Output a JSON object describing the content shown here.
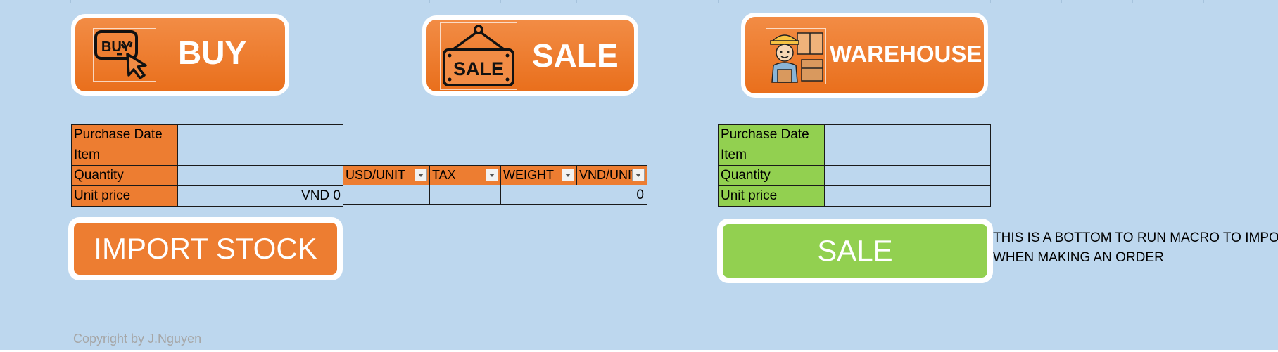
{
  "nav": {
    "buy_label": "BUY",
    "buy_icon_text": "BUY",
    "sale_label": "SALE",
    "sale_icon_text": "SALE",
    "warehouse_label": "WAREHOUSE"
  },
  "purchase_form": {
    "rows": [
      {
        "label": "Purchase Date",
        "value": ""
      },
      {
        "label": "Item",
        "value": ""
      },
      {
        "label": "Quantity",
        "value": ""
      },
      {
        "label": "Unit price",
        "value": "VND 0"
      }
    ]
  },
  "calc": {
    "headers": [
      "USD/UNIT",
      "TAX",
      "WEIGHT",
      "VND/UNIT"
    ],
    "result": "0"
  },
  "sale_form": {
    "rows": [
      {
        "label": "Purchase Date",
        "value": ""
      },
      {
        "label": "Item",
        "value": ""
      },
      {
        "label": "Quantity",
        "value": ""
      },
      {
        "label": "Unit price",
        "value": ""
      }
    ]
  },
  "actions": {
    "import_label": "IMPORT STOCK",
    "sale_label": "SALE"
  },
  "note": {
    "line1": "THIS IS A BOTTOM TO RUN MACRO TO IMPORT",
    "line2": "WHEN MAKING AN ORDER"
  },
  "copyright": "Copyright by J.Nguyen",
  "colors": {
    "background": "#bdd7ee",
    "orange": "#ed7d31",
    "green": "#92d050"
  },
  "icons": [
    "buy-click-icon",
    "sale-sign-icon",
    "warehouse-worker-icon",
    "dropdown-arrow-icon"
  ]
}
